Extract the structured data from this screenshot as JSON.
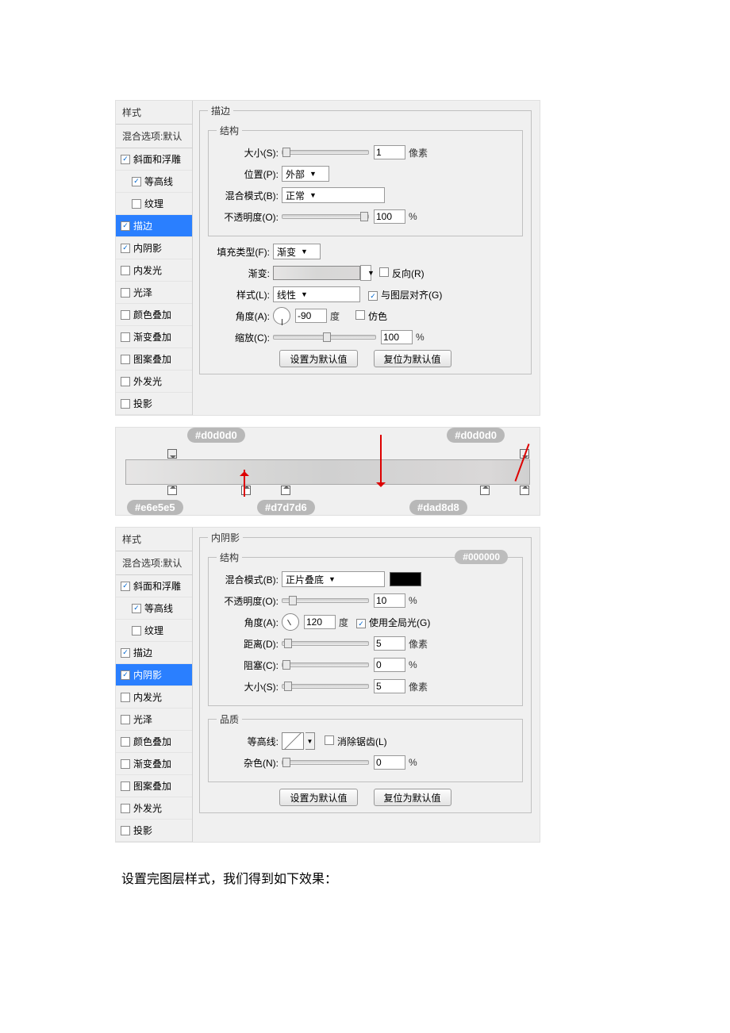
{
  "panel1": {
    "sidebarTitle": "样式",
    "blendDefault": "混合选项:默认",
    "items": [
      {
        "label": "斜面和浮雕",
        "checked": true,
        "indent": false
      },
      {
        "label": "等高线",
        "checked": true,
        "indent": true
      },
      {
        "label": "纹理",
        "checked": false,
        "indent": true
      },
      {
        "label": "描边",
        "checked": true,
        "indent": false,
        "selected": true
      },
      {
        "label": "内阴影",
        "checked": true,
        "indent": false
      },
      {
        "label": "内发光",
        "checked": false,
        "indent": false
      },
      {
        "label": "光泽",
        "checked": false,
        "indent": false
      },
      {
        "label": "颜色叠加",
        "checked": false,
        "indent": false
      },
      {
        "label": "渐变叠加",
        "checked": false,
        "indent": false
      },
      {
        "label": "图案叠加",
        "checked": false,
        "indent": false
      },
      {
        "label": "外发光",
        "checked": false,
        "indent": false
      },
      {
        "label": "投影",
        "checked": false,
        "indent": false
      }
    ],
    "mainTitle": "描边",
    "structTitle": "结构",
    "sizeLabel": "大小(S):",
    "sizeValue": "1",
    "sizeUnit": "像素",
    "positionLabel": "位置(P):",
    "positionValue": "外部",
    "blendLabel": "混合模式(B):",
    "blendValue": "正常",
    "opacityLabel": "不透明度(O):",
    "opacityValue": "100",
    "opacityUnit": "%",
    "fillTypeLabel": "填充类型(F):",
    "fillTypeValue": "渐变",
    "gradLabel": "渐变:",
    "reverseLabel": "反向(R)",
    "styleLabel": "样式(L):",
    "styleValue": "线性",
    "alignLabel": "与图层对齐(G)",
    "angleLabel": "角度(A):",
    "angleValue": "-90",
    "angleUnit": "度",
    "ditherLabel": "仿色",
    "scaleLabel": "缩放(C):",
    "scaleValue": "100",
    "scaleUnit": "%",
    "btnDefault": "设置为默认值",
    "btnReset": "复位为默认值",
    "gradStops": {
      "topLeft": "#d0d0d0",
      "topRight": "#d0d0d0",
      "botA": "#e6e5e5",
      "botB": "#d7d7d6",
      "botC": "#dad8d8"
    }
  },
  "panel2": {
    "sidebarTitle": "样式",
    "blendDefault": "混合选项:默认",
    "items": [
      {
        "label": "斜面和浮雕",
        "checked": true,
        "indent": false
      },
      {
        "label": "等高线",
        "checked": true,
        "indent": true
      },
      {
        "label": "纹理",
        "checked": false,
        "indent": true
      },
      {
        "label": "描边",
        "checked": true,
        "indent": false
      },
      {
        "label": "内阴影",
        "checked": true,
        "indent": false,
        "selected": true
      },
      {
        "label": "内发光",
        "checked": false,
        "indent": false
      },
      {
        "label": "光泽",
        "checked": false,
        "indent": false
      },
      {
        "label": "颜色叠加",
        "checked": false,
        "indent": false
      },
      {
        "label": "渐变叠加",
        "checked": false,
        "indent": false
      },
      {
        "label": "图案叠加",
        "checked": false,
        "indent": false
      },
      {
        "label": "外发光",
        "checked": false,
        "indent": false
      },
      {
        "label": "投影",
        "checked": false,
        "indent": false
      }
    ],
    "mainTitle": "内阴影",
    "structTitle": "结构",
    "colorBadge": "#000000",
    "blendLabel": "混合模式(B):",
    "blendValue": "正片叠底",
    "opacityLabel": "不透明度(O):",
    "opacityValue": "10",
    "opacityUnit": "%",
    "angleLabel": "角度(A):",
    "angleValue": "120",
    "angleUnit": "度",
    "globalLabel": "使用全局光(G)",
    "distLabel": "距离(D):",
    "distValue": "5",
    "distUnit": "像素",
    "spreadLabel": "阻塞(C):",
    "spreadValue": "0",
    "spreadUnit": "%",
    "sizeLabel": "大小(S):",
    "sizeValue": "5",
    "sizeUnit": "像素",
    "qualityTitle": "品质",
    "contourLabel": "等高线:",
    "antiLabel": "消除锯齿(L)",
    "noiseLabel": "杂色(N):",
    "noiseValue": "0",
    "noiseUnit": "%",
    "btnDefault": "设置为默认值",
    "btnReset": "复位为默认值"
  },
  "caption": "设置完图层样式，我们得到如下效果："
}
